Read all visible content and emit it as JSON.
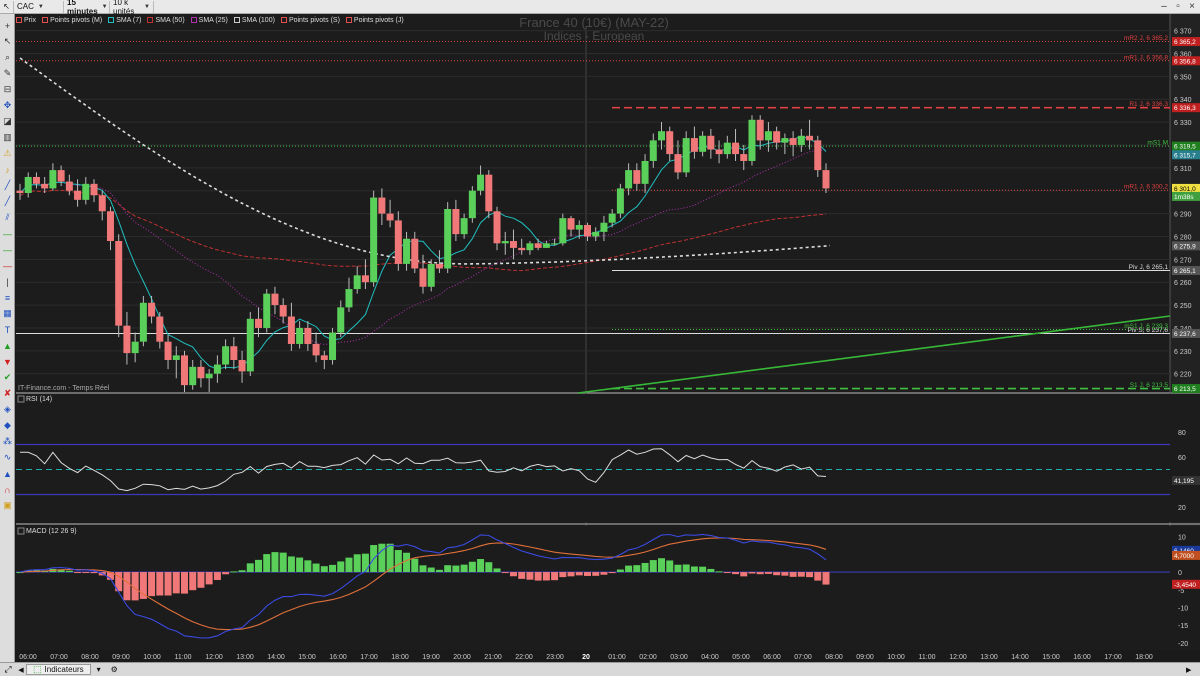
{
  "toolbar": {
    "symbol": "CAC",
    "interval": "15 minutes",
    "units": "10 k unités"
  },
  "legend": [
    {
      "label": "Prix",
      "color": "#e05050"
    },
    {
      "label": "Points pivots (M)",
      "color": "#e05050"
    },
    {
      "label": "SMA (7)",
      "color": "#20c0c0"
    },
    {
      "label": "SMA (50)",
      "color": "#c03030"
    },
    {
      "label": "SMA (25)",
      "color": "#b030b0"
    },
    {
      "label": "SMA (100)",
      "color": "#cccccc"
    },
    {
      "label": "Points pivots (S)",
      "color": "#e05050"
    },
    {
      "label": "Points pivots (J)",
      "color": "#e05050"
    }
  ],
  "chart_title": "France 40 (10€) (MAY-22)",
  "chart_subtitle": "Indices - European",
  "watermark": "IT-Finance.com - Temps Réel",
  "rsi_label": "RSI (14)",
  "macd_label": "MACD (12 26 9)",
  "bottom": {
    "indicators_label": "Indicateurs"
  },
  "colors": {
    "up": "#5ad05a",
    "down": "#f07878",
    "sma7": "#20c0c0",
    "sma25": "#b030b0",
    "sma50": "#c03030",
    "sma100": "#dddddd"
  },
  "chart_data": [
    {
      "type": "candlestick",
      "name": "price",
      "x_tick_labels": [
        "06:00",
        "07:00",
        "08:00",
        "09:00",
        "10:00",
        "11:00",
        "12:00",
        "13:00",
        "14:00",
        "15:00",
        "16:00",
        "17:00",
        "18:00",
        "19:00",
        "20:00",
        "21:00",
        "22:00",
        "23:00",
        "20",
        "01:00",
        "02:00",
        "03:00",
        "04:00",
        "05:00",
        "06:00",
        "07:00",
        "08:00",
        "09:00",
        "10:00",
        "11:00",
        "12:00",
        "13:00",
        "14:00",
        "15:00",
        "16:00",
        "17:00",
        "18:00"
      ],
      "y_ticks": [
        6220,
        6230,
        6240,
        6250,
        6260,
        6270,
        6280,
        6290,
        6300,
        6310,
        6320,
        6330,
        6340,
        6350,
        6360,
        6370
      ],
      "ylim": [
        6212,
        6372
      ],
      "candles": [
        [
          6300,
          6303,
          6296,
          6299
        ],
        [
          6299,
          6308,
          6297,
          6306
        ],
        [
          6306,
          6308,
          6301,
          6303
        ],
        [
          6303,
          6306,
          6299,
          6301
        ],
        [
          6301,
          6312,
          6300,
          6309
        ],
        [
          6309,
          6311,
          6302,
          6304
        ],
        [
          6304,
          6307,
          6298,
          6300
        ],
        [
          6300,
          6305,
          6293,
          6296
        ],
        [
          6296,
          6306,
          6294,
          6303
        ],
        [
          6303,
          6305,
          6295,
          6298
        ],
        [
          6298,
          6300,
          6287,
          6291
        ],
        [
          6291,
          6293,
          6274,
          6278
        ],
        [
          6278,
          6281,
          6236,
          6241
        ],
        [
          6241,
          6247,
          6224,
          6229
        ],
        [
          6229,
          6238,
          6225,
          6234
        ],
        [
          6234,
          6254,
          6232,
          6251
        ],
        [
          6251,
          6254,
          6242,
          6245
        ],
        [
          6245,
          6247,
          6231,
          6234
        ],
        [
          6234,
          6237,
          6222,
          6226
        ],
        [
          6226,
          6232,
          6218,
          6228
        ],
        [
          6228,
          6230,
          6212,
          6215
        ],
        [
          6215,
          6226,
          6213,
          6223
        ],
        [
          6223,
          6226,
          6214,
          6218
        ],
        [
          6218,
          6222,
          6212,
          6220
        ],
        [
          6220,
          6228,
          6216,
          6224
        ],
        [
          6224,
          6235,
          6222,
          6232
        ],
        [
          6232,
          6236,
          6222,
          6226
        ],
        [
          6226,
          6230,
          6216,
          6221
        ],
        [
          6221,
          6247,
          6219,
          6244
        ],
        [
          6244,
          6249,
          6236,
          6240
        ],
        [
          6240,
          6257,
          6238,
          6255
        ],
        [
          6255,
          6258,
          6246,
          6250
        ],
        [
          6250,
          6253,
          6242,
          6245
        ],
        [
          6245,
          6251,
          6230,
          6233
        ],
        [
          6233,
          6243,
          6231,
          6240
        ],
        [
          6240,
          6243,
          6230,
          6233
        ],
        [
          6233,
          6238,
          6225,
          6228
        ],
        [
          6228,
          6230,
          6222,
          6226
        ],
        [
          6226,
          6240,
          6224,
          6238
        ],
        [
          6238,
          6252,
          6236,
          6249
        ],
        [
          6249,
          6262,
          6247,
          6257
        ],
        [
          6257,
          6267,
          6255,
          6263
        ],
        [
          6263,
          6270,
          6257,
          6260
        ],
        [
          6260,
          6300,
          6258,
          6297
        ],
        [
          6297,
          6301,
          6285,
          6290
        ],
        [
          6290,
          6296,
          6284,
          6287
        ],
        [
          6287,
          6291,
          6265,
          6268
        ],
        [
          6268,
          6282,
          6265,
          6279
        ],
        [
          6279,
          6282,
          6264,
          6266
        ],
        [
          6266,
          6272,
          6255,
          6258
        ],
        [
          6258,
          6270,
          6256,
          6268
        ],
        [
          6268,
          6274,
          6264,
          6266
        ],
        [
          6266,
          6295,
          6264,
          6292
        ],
        [
          6292,
          6296,
          6278,
          6281
        ],
        [
          6281,
          6290,
          6279,
          6288
        ],
        [
          6288,
          6302,
          6286,
          6300
        ],
        [
          6300,
          6311,
          6298,
          6307
        ],
        [
          6307,
          6309,
          6288,
          6291
        ],
        [
          6291,
          6293,
          6274,
          6277
        ],
        [
          6277,
          6282,
          6272,
          6278
        ],
        [
          6278,
          6283,
          6270,
          6275
        ],
        [
          6275,
          6279,
          6272,
          6274
        ],
        [
          6274,
          6278,
          6272,
          6277
        ],
        [
          6277,
          6279,
          6274,
          6275
        ],
        [
          6275,
          6278,
          6275,
          6277
        ],
        [
          6277,
          6279,
          6276,
          6277
        ],
        [
          6277,
          6290,
          6276,
          6288
        ],
        [
          6288,
          6289,
          6280,
          6283
        ],
        [
          6283,
          6287,
          6279,
          6285
        ],
        [
          6285,
          6286,
          6278,
          6280
        ],
        [
          6280,
          6284,
          6278,
          6282
        ],
        [
          6282,
          6289,
          6278,
          6286
        ],
        [
          6286,
          6292,
          6284,
          6290
        ],
        [
          6290,
          6303,
          6288,
          6301
        ],
        [
          6301,
          6312,
          6298,
          6309
        ],
        [
          6309,
          6312,
          6300,
          6303
        ],
        [
          6303,
          6316,
          6299,
          6313
        ],
        [
          6313,
          6325,
          6310,
          6322
        ],
        [
          6322,
          6330,
          6318,
          6326
        ],
        [
          6326,
          6328,
          6313,
          6316
        ],
        [
          6316,
          6322,
          6305,
          6308
        ],
        [
          6308,
          6326,
          6306,
          6323
        ],
        [
          6323,
          6328,
          6314,
          6317
        ],
        [
          6317,
          6326,
          6315,
          6324
        ],
        [
          6324,
          6327,
          6314,
          6318
        ],
        [
          6318,
          6322,
          6312,
          6316
        ],
        [
          6316,
          6324,
          6314,
          6321
        ],
        [
          6321,
          6327,
          6313,
          6316
        ],
        [
          6316,
          6320,
          6309,
          6313
        ],
        [
          6313,
          6333,
          6311,
          6331
        ],
        [
          6331,
          6333,
          6318,
          6322
        ],
        [
          6322,
          6330,
          6317,
          6326
        ],
        [
          6326,
          6328,
          6318,
          6321
        ],
        [
          6321,
          6325,
          6316,
          6323
        ],
        [
          6323,
          6326,
          6315,
          6320
        ],
        [
          6320,
          6327,
          6317,
          6324
        ],
        [
          6324,
          6331,
          6318,
          6322
        ],
        [
          6322,
          6324,
          6306,
          6309
        ],
        [
          6309,
          6312,
          6299,
          6301
        ]
      ],
      "pivot_lines": [
        {
          "label": "mR2 J, 6 365,2",
          "value": 6365.2,
          "color": "#e04040",
          "style": "dotted"
        },
        {
          "label": "mR1 J, 6 356,8",
          "value": 6356.8,
          "color": "#e04040",
          "style": "dotted"
        },
        {
          "label": "R1 J, 6 336,3",
          "value": 6336.3,
          "color": "#e04040",
          "style": "dashed"
        },
        {
          "label": "mS1 M",
          "value": 6319.5,
          "color": "#40c040",
          "style": "dotted"
        },
        {
          "label": "mR1 J, 6 300,2",
          "value": 6300.2,
          "color": "#e04040",
          "style": "dotted"
        },
        {
          "label": "Piv J, 6 265,1",
          "value": 6265.1,
          "color": "#dddddd",
          "style": "solid"
        },
        {
          "label": "Piv S, 6 237,6",
          "value": 6237.6,
          "color": "#dddddd",
          "style": "solid"
        },
        {
          "label": "mS1 J, 6 239,3",
          "value": 6239.3,
          "color": "#40c040",
          "style": "dotted"
        },
        {
          "label": "S1 J, 6 213,5",
          "value": 6213.5,
          "color": "#40c040",
          "style": "dashed"
        }
      ],
      "right_tags": [
        {
          "text": "6 365,2",
          "value": 6365.2,
          "bg": "#c02020"
        },
        {
          "text": "6 356,8",
          "value": 6356.8,
          "bg": "#c02020"
        },
        {
          "text": "6 336,3",
          "value": 6336.3,
          "bg": "#c02020"
        },
        {
          "text": "6 319,5",
          "value": 6319.5,
          "bg": "#208020"
        },
        {
          "text": "6 315,7",
          "value": 6315.7,
          "bg": "#2a7f8f"
        },
        {
          "text": "6 301,0",
          "value": 6301.0,
          "bg": "#f0e040",
          "fg": "#000"
        },
        {
          "text": "1m38s",
          "value": 6297.5,
          "bg": "#40a040"
        },
        {
          "text": "6 275,9",
          "value": 6275.9,
          "bg": "#555555"
        },
        {
          "text": "6 265,1",
          "value": 6265.1,
          "bg": "#555555"
        },
        {
          "text": "6 237,6",
          "value": 6237.6,
          "bg": "#555555"
        },
        {
          "text": "6 213,5",
          "value": 6213.5,
          "bg": "#208020"
        }
      ]
    },
    {
      "type": "line",
      "name": "RSI (14)",
      "y_ticks": [
        20,
        40,
        60,
        80
      ],
      "ylim": [
        8,
        100
      ],
      "bands": [
        70,
        30
      ],
      "midline": 50,
      "last_value": "41,195"
    },
    {
      "type": "bar",
      "name": "MACD (12 26 9)",
      "y_ticks": [
        -20,
        -15,
        -10,
        -5,
        0,
        5,
        10
      ],
      "ylim": [
        -22,
        13
      ],
      "right_tags": [
        {
          "text": "6,1460",
          "value": 6.146,
          "bg": "#1a3a9a"
        },
        {
          "text": "4,7000",
          "value": 4.7,
          "bg": "#c05020"
        },
        {
          "text": "-3,4540",
          "value": -3.454,
          "bg": "#c02020"
        }
      ]
    }
  ]
}
